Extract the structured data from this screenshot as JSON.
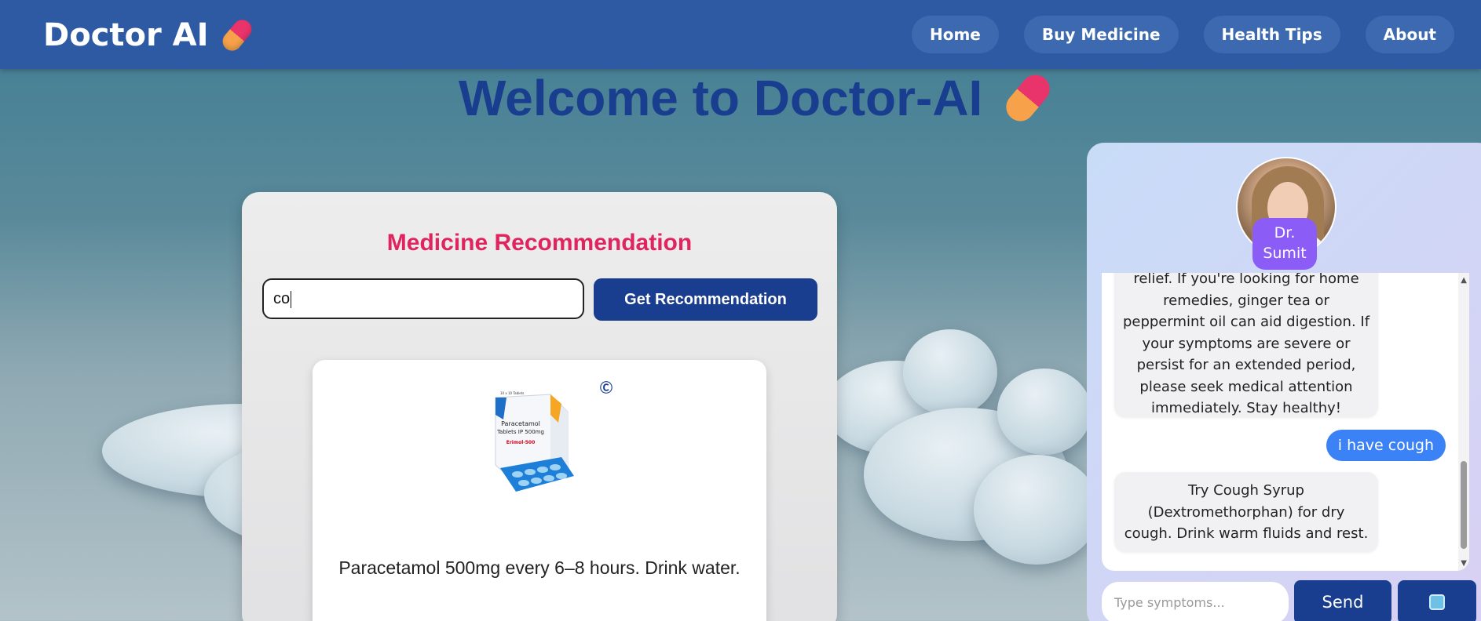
{
  "navbar": {
    "brand": "Doctor AI",
    "links": [
      {
        "label": "Home"
      },
      {
        "label": "Buy Medicine"
      },
      {
        "label": "Health Tips"
      },
      {
        "label": "About"
      }
    ]
  },
  "hero": {
    "title": "Welcome to Doctor-AI"
  },
  "recommendation": {
    "title": "Medicine Recommendation",
    "input_value": "co",
    "button_label": "Get Recommendation",
    "result_text": "Paracetamol 500mg every 6–8 hours. Drink water.",
    "product_image_text": {
      "line1": "Paracetamol",
      "line2": "Tablets IP 500mg",
      "brand": "Erimol-500",
      "pack": "10 x 10 Tablets"
    }
  },
  "chat": {
    "doctor_name": "Dr. Sumit",
    "messages": [
      {
        "from": "bot",
        "text": "relief. If you're looking for home remedies, ginger tea or peppermint oil can aid digestion. If your symptoms are severe or persist for an extended period, please seek medical attention immediately. Stay healthy!"
      },
      {
        "from": "user",
        "text": "i have cough"
      },
      {
        "from": "bot",
        "text": "Try Cough Syrup (Dextromethorphan) for dry cough. Drink warm fluids and rest."
      }
    ],
    "input_placeholder": "Type symptoms...",
    "send_label": "Send"
  },
  "colors": {
    "navbar": "#2e5aa3",
    "primary": "#1a3e8f",
    "accent_pink": "#e0245e",
    "user_bubble": "#3b82f6",
    "badge_purple": "#8b5cf6"
  },
  "icons": [
    "pill-icon",
    "mic-icon",
    "scroll-up-icon",
    "scroll-down-icon",
    "badge-icon"
  ]
}
